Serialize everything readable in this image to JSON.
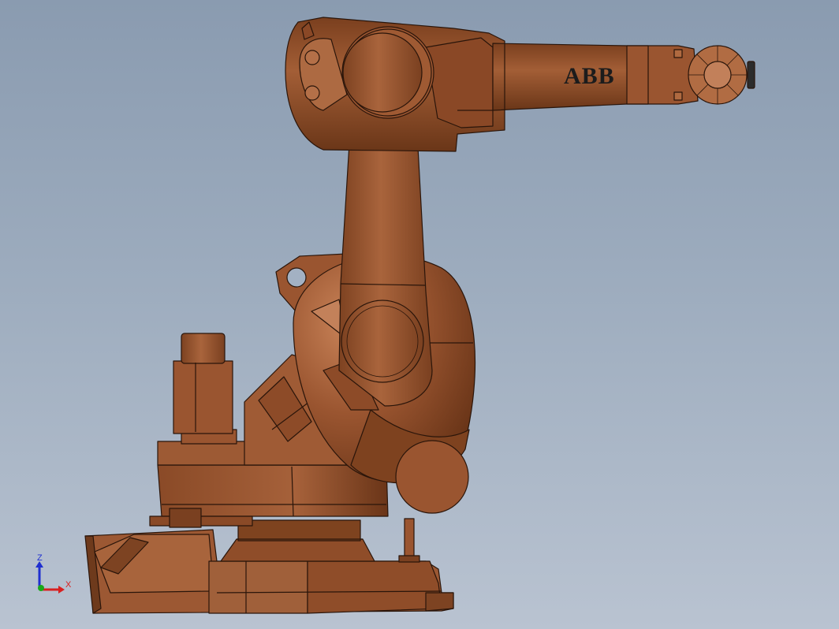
{
  "app": {
    "view_kind": "3D model viewport"
  },
  "model": {
    "brand_text": "ABB",
    "body_color": "#9a5530",
    "body_light": "#b36b43",
    "body_dark": "#6e3a1c",
    "edge_color": "#2a150a"
  },
  "triad": {
    "z_label": "Z",
    "x_label": "X",
    "z_color": "#1f2fd0",
    "x_color": "#d82020",
    "y_color": "#1aa81a"
  }
}
